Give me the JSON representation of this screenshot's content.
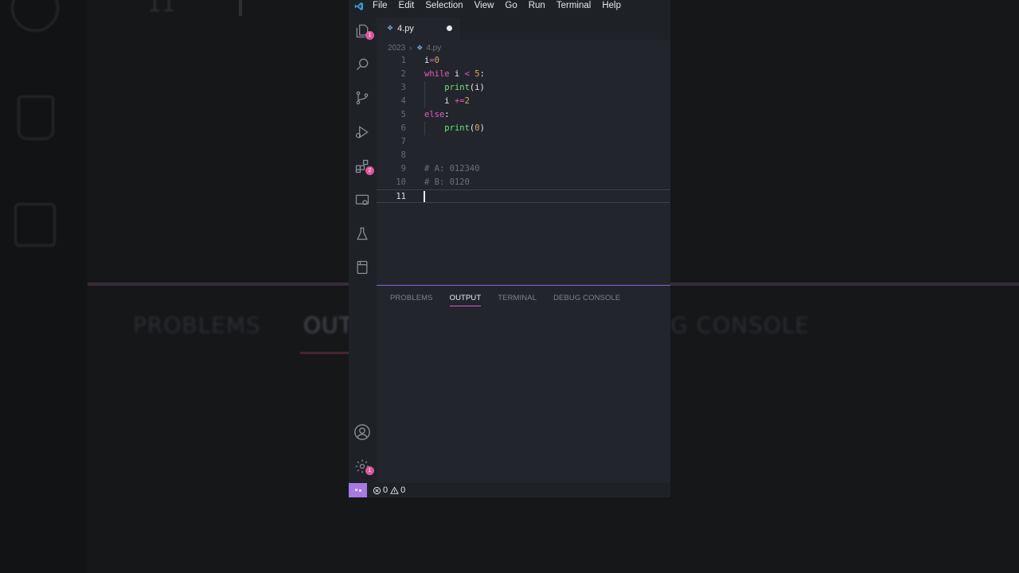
{
  "colors": {
    "accent": "#a779e4",
    "badge": "#e2559b",
    "keyword": "#e45ac2",
    "function": "#6fe07a",
    "number": "#d7a76c",
    "comment": "#6b7078",
    "editor_bg": "#22262c"
  },
  "menubar": {
    "items": [
      "File",
      "Edit",
      "Selection",
      "View",
      "Go",
      "Run",
      "Terminal",
      "Help"
    ]
  },
  "activity_bar": {
    "explorer_badge": "1",
    "extensions_badge": "2",
    "settings_badge": "1"
  },
  "tabs": [
    {
      "label": "4.py",
      "icon": "python-file-icon",
      "dirty": true
    }
  ],
  "breadcrumb": {
    "folder": "2023",
    "file": "4.py"
  },
  "editor": {
    "lines": [
      {
        "num": "1",
        "tokens": [
          {
            "t": "i",
            "c": "var"
          },
          {
            "t": "=",
            "c": "op"
          },
          {
            "t": "0",
            "c": "num"
          }
        ]
      },
      {
        "num": "2",
        "tokens": [
          {
            "t": "while",
            "c": "kw"
          },
          {
            "t": " i ",
            "c": "var"
          },
          {
            "t": "<",
            "c": "op"
          },
          {
            "t": " ",
            "c": "var"
          },
          {
            "t": "5",
            "c": "num"
          },
          {
            "t": ":",
            "c": "punc"
          }
        ]
      },
      {
        "num": "3",
        "indent": true,
        "tokens": [
          {
            "t": "    ",
            "c": "var"
          },
          {
            "t": "print",
            "c": "fn"
          },
          {
            "t": "(i)",
            "c": "punc"
          }
        ]
      },
      {
        "num": "4",
        "indent": true,
        "tokens": [
          {
            "t": "    i ",
            "c": "var"
          },
          {
            "t": "+=",
            "c": "op"
          },
          {
            "t": "2",
            "c": "num"
          }
        ]
      },
      {
        "num": "5",
        "tokens": [
          {
            "t": "else",
            "c": "kw"
          },
          {
            "t": ":",
            "c": "punc"
          }
        ]
      },
      {
        "num": "6",
        "indent": true,
        "tokens": [
          {
            "t": "    ",
            "c": "var"
          },
          {
            "t": "print",
            "c": "fn"
          },
          {
            "t": "(",
            "c": "punc"
          },
          {
            "t": "0",
            "c": "num"
          },
          {
            "t": ")",
            "c": "punc"
          }
        ]
      },
      {
        "num": "7",
        "tokens": []
      },
      {
        "num": "8",
        "tokens": []
      },
      {
        "num": "9",
        "tokens": [
          {
            "t": "# A: 012340",
            "c": "comment"
          }
        ]
      },
      {
        "num": "10",
        "tokens": [
          {
            "t": "# B: 0120",
            "c": "comment"
          }
        ]
      },
      {
        "num": "11",
        "current": true,
        "tokens": []
      }
    ]
  },
  "panel": {
    "tabs": [
      {
        "label": "PROBLEMS",
        "active": false
      },
      {
        "label": "OUTPUT",
        "active": true
      },
      {
        "label": "TERMINAL",
        "active": false
      },
      {
        "label": "DEBUG CONSOLE",
        "active": false
      }
    ]
  },
  "statusbar": {
    "errors": "0",
    "warnings": "0"
  },
  "background": {
    "line_number": "11",
    "tabs": [
      "PROBLEMS",
      "OUT",
      "G CONSOLE"
    ]
  }
}
